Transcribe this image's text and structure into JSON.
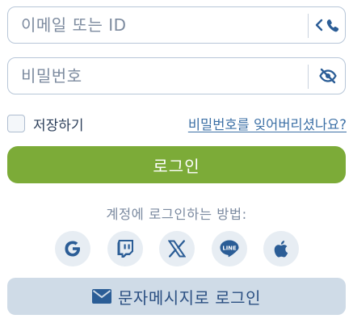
{
  "email_field": {
    "placeholder": "이메일 또는 ID",
    "suffix_icons": [
      "chevron-left-icon",
      "phone-icon"
    ]
  },
  "password_field": {
    "placeholder": "비밀번호",
    "suffix_icon": "eye-off-icon"
  },
  "remember": {
    "label": "저장하기",
    "checked": false
  },
  "forgot_link": "비밀번호를 잊어버리셨나요?",
  "login_button": "로그인",
  "methods_label": "계정에 로그인하는 방법:",
  "social_buttons": [
    {
      "name": "google",
      "icon": "google-icon"
    },
    {
      "name": "twitch",
      "icon": "twitch-icon"
    },
    {
      "name": "x",
      "icon": "x-icon"
    },
    {
      "name": "line",
      "icon": "line-icon",
      "text": "LINE"
    },
    {
      "name": "apple",
      "icon": "apple-icon"
    }
  ],
  "sms_button": {
    "label": "문자메시지로 로그인",
    "icon": "envelope-icon"
  },
  "colors": {
    "accent_green": "#7cab38",
    "icon_blue": "#2b5d96",
    "link_blue": "#3b6fa5",
    "sms_bg": "#cfdbe7"
  }
}
